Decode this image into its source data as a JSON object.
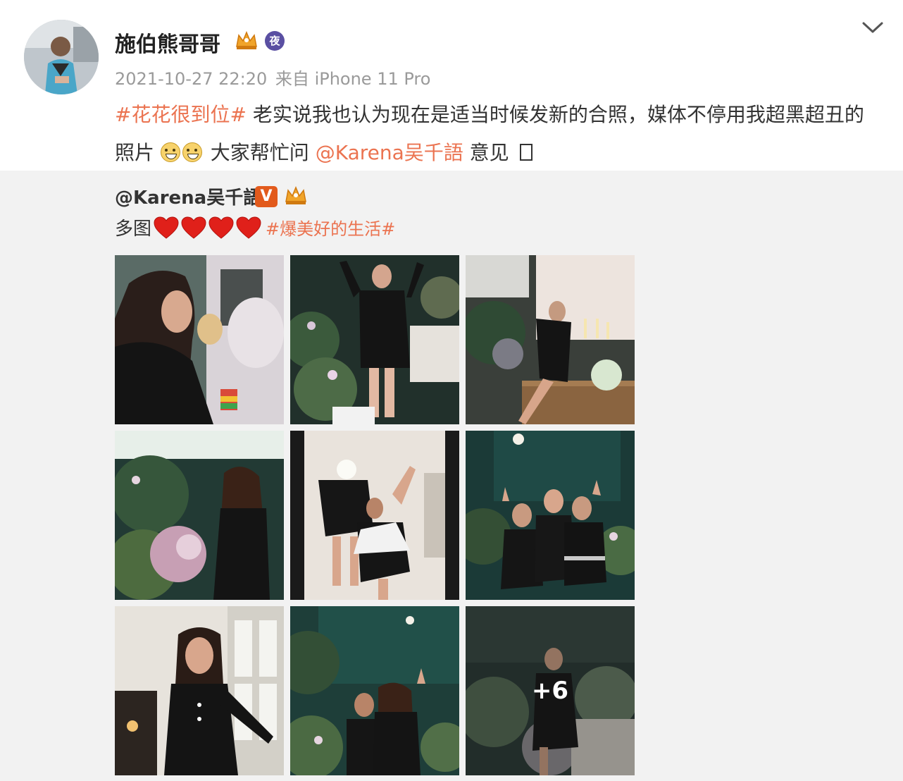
{
  "post": {
    "username": "施伯熊哥哥",
    "timestamp": "2021-10-27 22:20",
    "source_prefix": "来自",
    "device": "iPhone 11 Pro",
    "badges": [
      "crown-badge-icon",
      "night-badge-icon"
    ],
    "night_badge_label": "夜",
    "content": {
      "hashtag": "#花花很到位#",
      "text_1": " 老实说我也认为现在是适当时候发新的合照，媒体不停用我超黑超丑的照片 ",
      "text_2": " 大家帮忙问 ",
      "mention": "@Karena吴千語",
      "text_3": " 意见 "
    }
  },
  "repost": {
    "username": "@Karena吴千語",
    "verified_label": "V",
    "text": "多图",
    "hearts_count": 4,
    "hashtag": "#爆美好的生活#",
    "images_more_label": "+6"
  },
  "colors": {
    "link": "#eb7350",
    "repost_bg": "#f2f2f2",
    "verified": "#e25a1c"
  }
}
